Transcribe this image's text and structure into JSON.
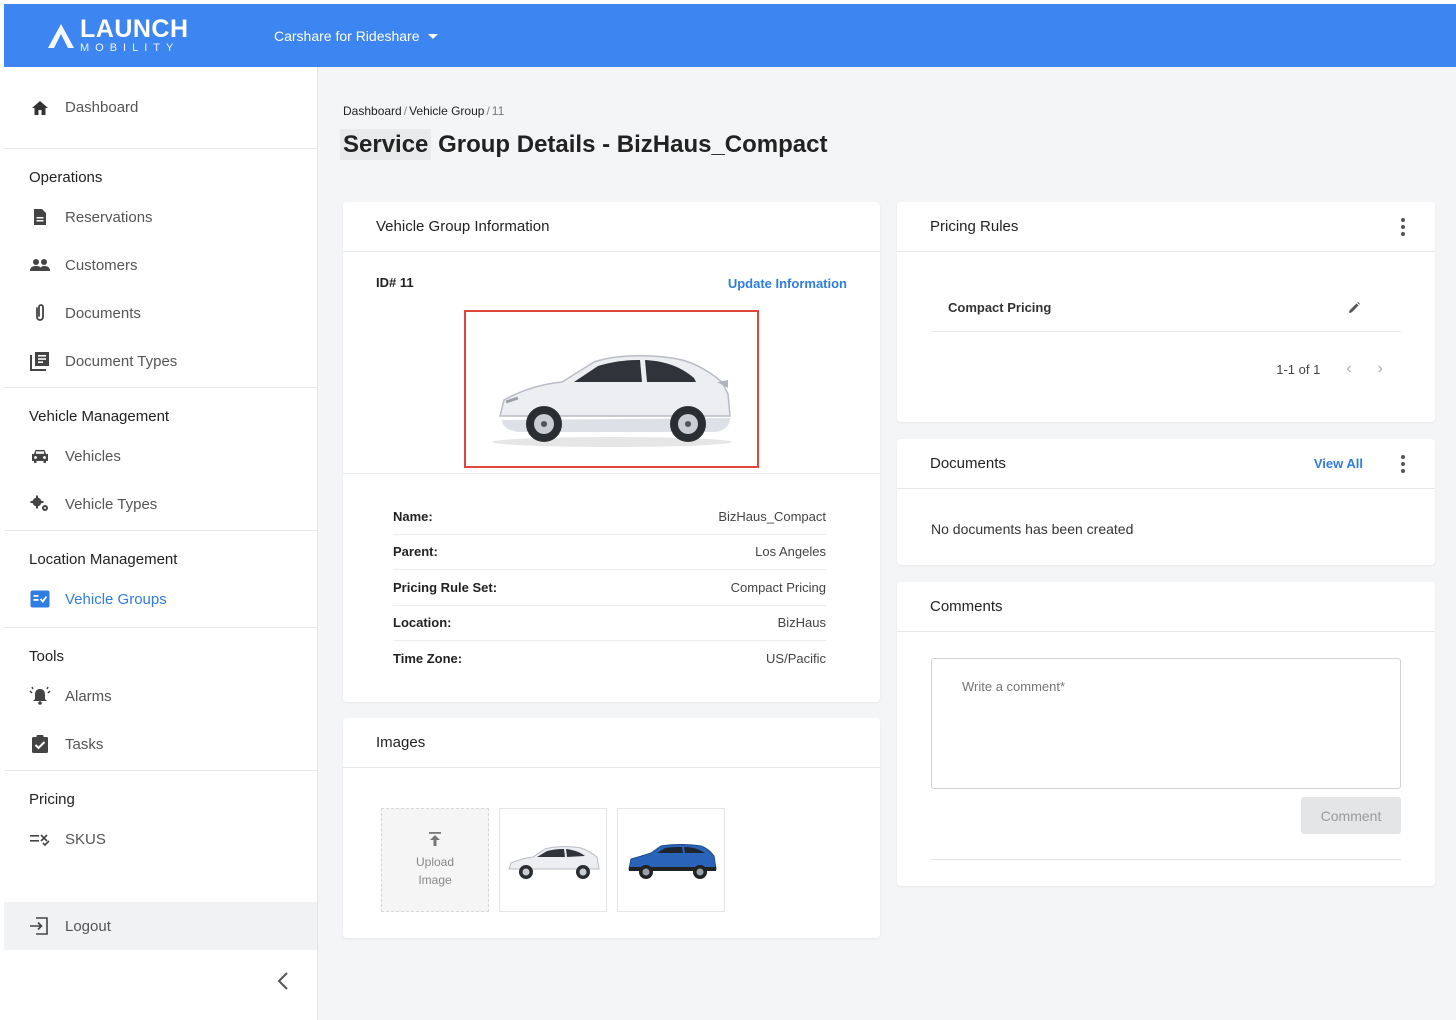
{
  "brand": {
    "name": "LAUNCH",
    "sub": "MOBILITY",
    "color": "#3d86f2"
  },
  "header": {
    "app_switcher": "Carshare for Rideshare"
  },
  "sidebar": {
    "dashboard": "Dashboard",
    "sections": {
      "operations": "Operations",
      "vehicle_management": "Vehicle Management",
      "location_management": "Location Management",
      "tools": "Tools",
      "pricing": "Pricing"
    },
    "items": {
      "reservations": "Reservations",
      "customers": "Customers",
      "documents": "Documents",
      "document_types": "Document Types",
      "vehicles": "Vehicles",
      "vehicle_types": "Vehicle Types",
      "vehicle_groups": "Vehicle Groups",
      "alarms": "Alarms",
      "tasks": "Tasks",
      "skus": "SKUS"
    },
    "active": "vehicle_groups",
    "logout": "Logout"
  },
  "breadcrumb": {
    "root": "Dashboard",
    "parent": "Vehicle Group",
    "current": "11",
    "sep": "/"
  },
  "page": {
    "title_highlight": "Service",
    "title_rest": " Group Details - BizHaus_Compact"
  },
  "vehicle_group": {
    "heading": "Vehicle Group Information",
    "id_label": "ID# 11",
    "update_link": "Update Information",
    "fields": [
      {
        "label": "Name:",
        "value": "BizHaus_Compact"
      },
      {
        "label": "Parent:",
        "value": "Los Angeles"
      },
      {
        "label": "Pricing Rule Set:",
        "value": "Compact Pricing"
      },
      {
        "label": "Location:",
        "value": "BizHaus"
      },
      {
        "label": "Time Zone:",
        "value": "US/Pacific"
      }
    ]
  },
  "images": {
    "heading": "Images",
    "upload_line1": "Upload",
    "upload_line2": "Image"
  },
  "pricing_rules": {
    "heading": "Pricing Rules",
    "rule": "Compact Pricing",
    "pagination": "1-1 of 1"
  },
  "documents": {
    "heading": "Documents",
    "view_all": "View All",
    "empty": "No documents has been created"
  },
  "comments": {
    "heading": "Comments",
    "placeholder": "Write a comment*",
    "button": "Comment"
  }
}
